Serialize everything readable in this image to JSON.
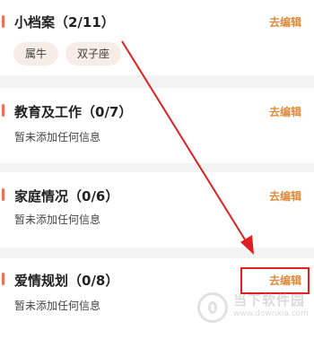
{
  "sections": [
    {
      "title": "小档案（2/11）",
      "edit_label": "去编辑",
      "tags": [
        "属牛",
        "双子座"
      ]
    },
    {
      "title": "教育及工作（0/7）",
      "edit_label": "去编辑",
      "empty_text": "暂未添加任何信息"
    },
    {
      "title": "家庭情况（0/6）",
      "edit_label": "去编辑",
      "empty_text": "暂未添加任何信息"
    },
    {
      "title": "爱情规划（0/8）",
      "edit_label": "去编辑",
      "empty_text": "暂未添加任何信息"
    }
  ],
  "colors": {
    "accent_bar": "#f26d5b",
    "edit_link": "#e08a3c",
    "tag_bg": "#f7ede6",
    "annotation_red": "#e02020",
    "page_bg": "#f3f3f3"
  },
  "watermark": {
    "name": "当下软件园",
    "url": "www.downxia.com"
  }
}
